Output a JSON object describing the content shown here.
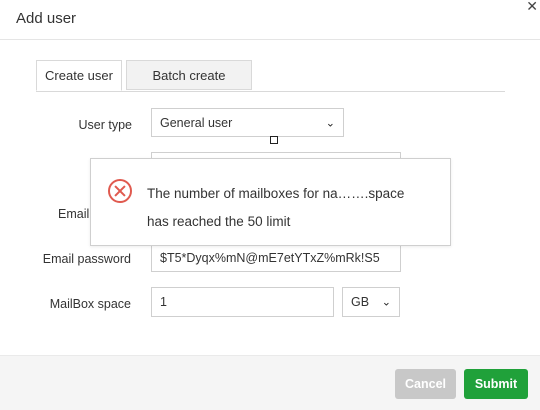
{
  "dialog": {
    "title": "Add user",
    "close_icon": "close-icon"
  },
  "tabs": [
    {
      "label": "Create user",
      "active": true
    },
    {
      "label": "Batch create",
      "active": false
    }
  ],
  "form": {
    "user_type": {
      "label": "User type",
      "value": "General user"
    },
    "email_account": {
      "label": "Email a",
      "value": ""
    },
    "email_password": {
      "label": "Email password",
      "value": "$T5*Dyqx%mN@mE7etYTxZ%mRk!S5"
    },
    "mailbox_space": {
      "label": "MailBox space",
      "value": "1",
      "unit": "GB"
    }
  },
  "toast": {
    "icon": "error-circle-icon",
    "line1": "The number of mailboxes for na…….space",
    "line2": "has reached the 50 limit",
    "color": "#e05a4f"
  },
  "footer": {
    "cancel_label": "Cancel",
    "submit_label": "Submit",
    "submit_color": "#20a13a",
    "cancel_color": "#c8c8c8"
  }
}
